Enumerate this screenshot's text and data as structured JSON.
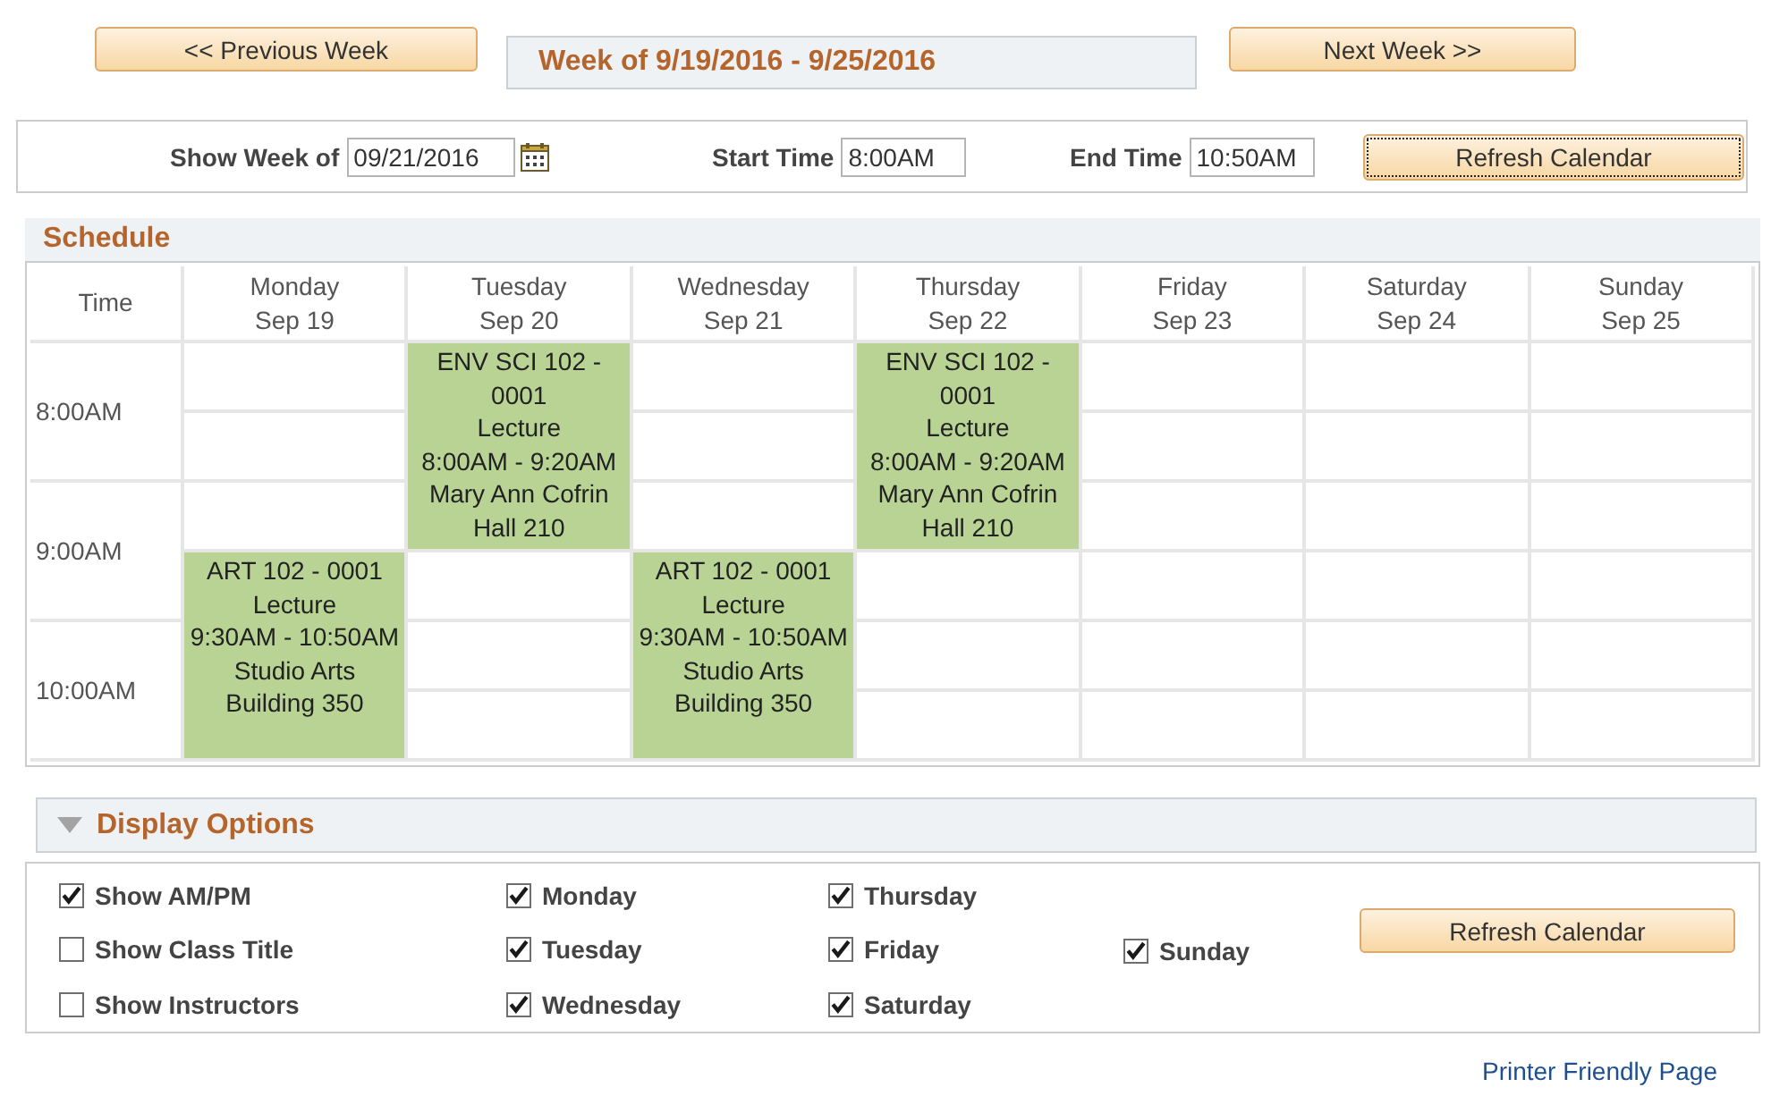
{
  "navigation": {
    "previous_button": "<< Previous Week",
    "week_title": "Week of 9/19/2016 - 9/25/2016",
    "next_button": "Next Week >>"
  },
  "filter": {
    "fields": [
      {
        "kind": "date",
        "label": "Show Week of",
        "value": "09/21/2016"
      },
      {
        "kind": "time",
        "label": "Start Time",
        "value": "8:00AM"
      },
      {
        "kind": "time",
        "label": "End Time",
        "value": "10:50AM"
      }
    ],
    "refresh_button": {
      "label": "Refresh Calendar",
      "focused": true
    }
  },
  "schedule": {
    "title": "Schedule",
    "time_header": "Time",
    "time_labels": [
      "8:00AM",
      "9:00AM",
      "10:00AM"
    ],
    "days": [
      {
        "name": "Monday",
        "date": "Sep 19",
        "slots": [
          {
            "kind": "empty"
          },
          {
            "kind": "empty"
          },
          {
            "kind": "empty"
          },
          {
            "kind": "class",
            "course": "ART 102 - 0001",
            "component": "Lecture",
            "time": "9:30AM - 10:50AM",
            "location": "Studio Arts Building 350"
          },
          {
            "kind": "continued"
          },
          {
            "kind": "continued"
          }
        ]
      },
      {
        "name": "Tuesday",
        "date": "Sep 20",
        "slots": [
          {
            "kind": "class",
            "course": "ENV SCI 102 - 0001",
            "component": "Lecture",
            "time": "8:00AM - 9:20AM",
            "location": "Mary Ann Cofrin Hall 210"
          },
          {
            "kind": "continued"
          },
          {
            "kind": "continued"
          },
          {
            "kind": "empty"
          },
          {
            "kind": "empty"
          },
          {
            "kind": "empty"
          }
        ]
      },
      {
        "name": "Wednesday",
        "date": "Sep 21",
        "slots": [
          {
            "kind": "empty"
          },
          {
            "kind": "empty"
          },
          {
            "kind": "empty"
          },
          {
            "kind": "class",
            "course": "ART 102 - 0001",
            "component": "Lecture",
            "time": "9:30AM - 10:50AM",
            "location": "Studio Arts Building 350"
          },
          {
            "kind": "continued"
          },
          {
            "kind": "continued"
          }
        ]
      },
      {
        "name": "Thursday",
        "date": "Sep 22",
        "slots": [
          {
            "kind": "class",
            "course": "ENV SCI 102 - 0001",
            "component": "Lecture",
            "time": "8:00AM - 9:20AM",
            "location": "Mary Ann Cofrin Hall 210"
          },
          {
            "kind": "continued"
          },
          {
            "kind": "continued"
          },
          {
            "kind": "empty"
          },
          {
            "kind": "empty"
          },
          {
            "kind": "empty"
          }
        ]
      },
      {
        "name": "Friday",
        "date": "Sep 23",
        "slots": [
          {
            "kind": "empty"
          },
          {
            "kind": "empty"
          },
          {
            "kind": "empty"
          },
          {
            "kind": "empty"
          },
          {
            "kind": "empty"
          },
          {
            "kind": "empty"
          }
        ]
      },
      {
        "name": "Saturday",
        "date": "Sep 24",
        "slots": [
          {
            "kind": "empty"
          },
          {
            "kind": "empty"
          },
          {
            "kind": "empty"
          },
          {
            "kind": "empty"
          },
          {
            "kind": "empty"
          },
          {
            "kind": "empty"
          }
        ]
      },
      {
        "name": "Sunday",
        "date": "Sep 25",
        "slots": [
          {
            "kind": "empty"
          },
          {
            "kind": "empty"
          },
          {
            "kind": "empty"
          },
          {
            "kind": "empty"
          },
          {
            "kind": "empty"
          },
          {
            "kind": "empty"
          }
        ]
      }
    ]
  },
  "display_options": {
    "title": "Display Options",
    "expanded": true,
    "columns": [
      [
        {
          "label": "Show AM/PM",
          "checked": true
        },
        {
          "label": "Show Class Title",
          "checked": false
        },
        {
          "label": "Show Instructors",
          "checked": false
        }
      ],
      [
        {
          "label": "Monday",
          "checked": true
        },
        {
          "label": "Tuesday",
          "checked": true
        },
        {
          "label": "Wednesday",
          "checked": true
        }
      ],
      [
        {
          "label": "Thursday",
          "checked": true
        },
        {
          "label": "Friday",
          "checked": true
        },
        {
          "label": "Saturday",
          "checked": true
        }
      ],
      [
        {
          "label": "Sunday",
          "checked": true
        }
      ]
    ],
    "refresh_button": "Refresh Calendar"
  },
  "printer_link": "Printer Friendly Page"
}
